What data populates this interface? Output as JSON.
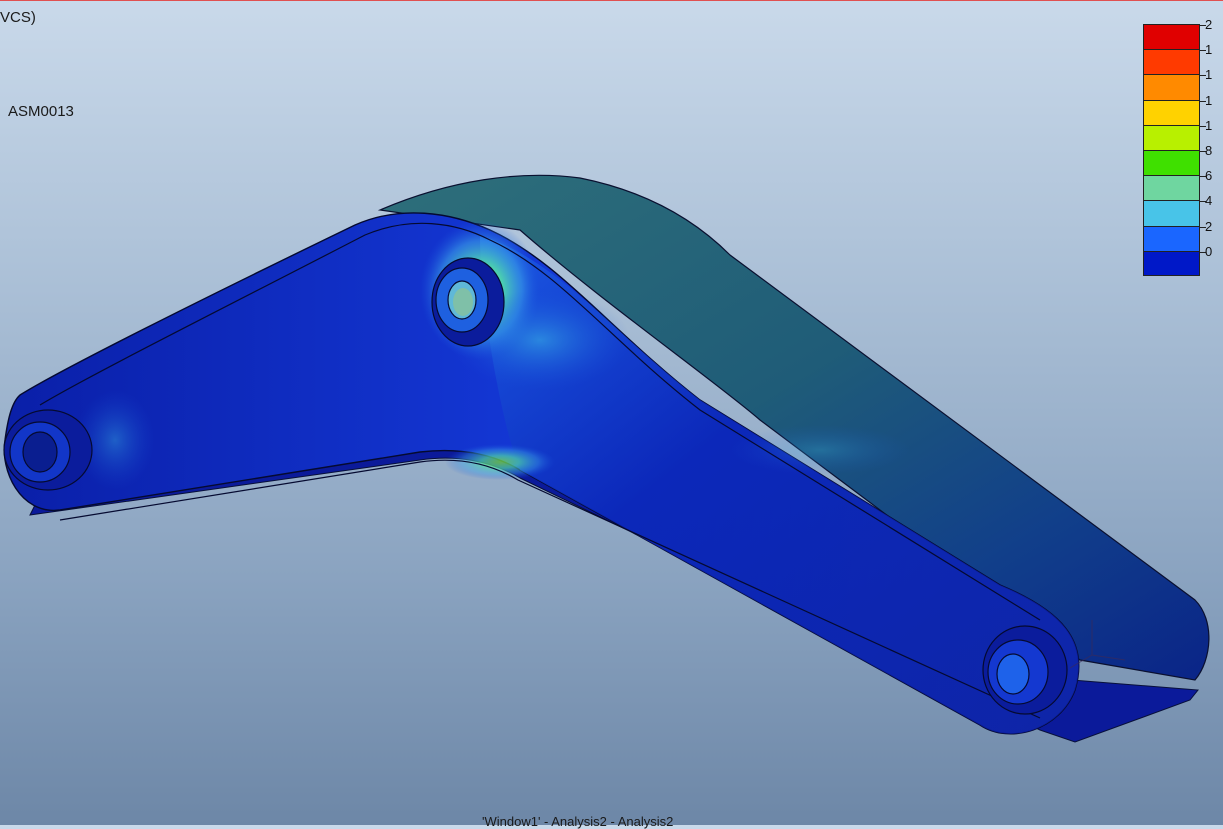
{
  "viewport": {
    "csys_label": "VCS)",
    "model_name": "ASM0013",
    "window_title": "'Window1' - Analysis2 - Analysis2"
  },
  "legend": {
    "colors": [
      "#e00000",
      "#ff3a00",
      "#ff8a00",
      "#ffd200",
      "#b8f000",
      "#3fe000",
      "#6fd6a0",
      "#48c4e8",
      "#1a66ff",
      "#0018c8"
    ],
    "tick_labels": [
      "2",
      "1",
      "1",
      "1",
      "1",
      "8",
      "6",
      "4",
      "2",
      "0"
    ]
  }
}
